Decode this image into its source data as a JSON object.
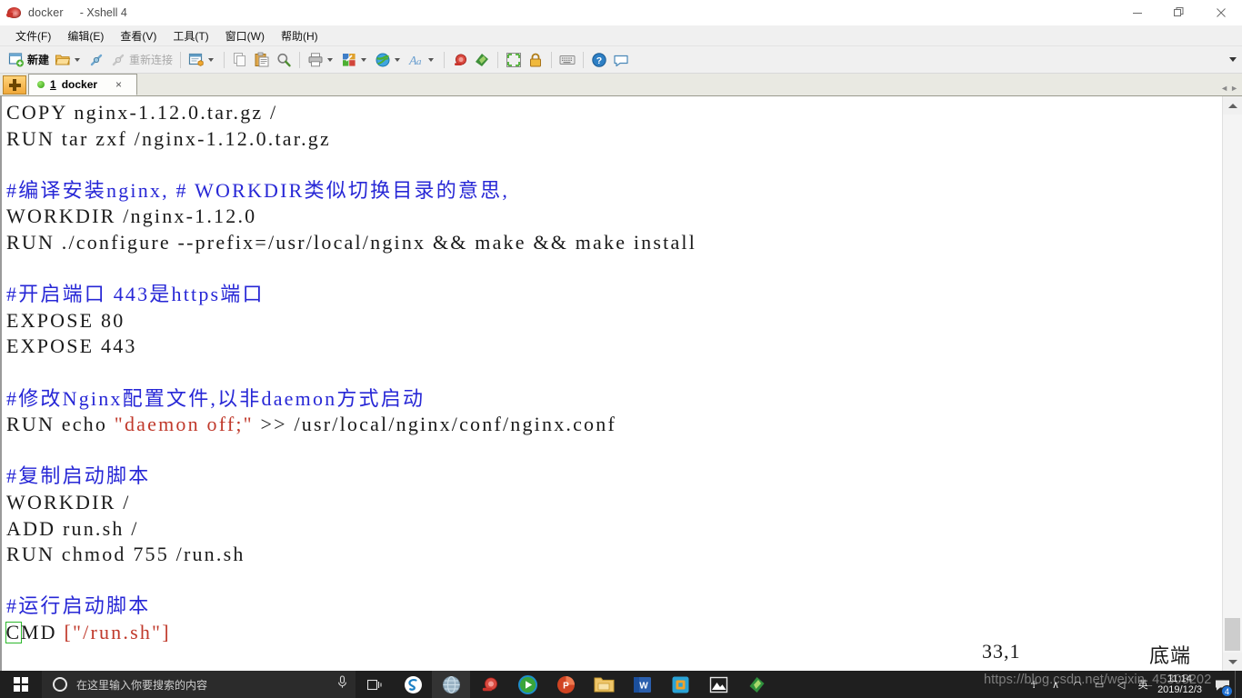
{
  "window": {
    "app_icon": "xshell-snail-icon",
    "title": "docker",
    "subtitle": "- Xshell 4",
    "controls": {
      "minimize": "minimize-icon",
      "maximize": "maximize-icon",
      "close": "close-icon"
    }
  },
  "menubar": {
    "items": [
      {
        "label": "文件(F)",
        "name": "menu-file"
      },
      {
        "label": "编辑(E)",
        "name": "menu-edit"
      },
      {
        "label": "查看(V)",
        "name": "menu-view"
      },
      {
        "label": "工具(T)",
        "name": "menu-tools"
      },
      {
        "label": "窗口(W)",
        "name": "menu-window"
      },
      {
        "label": "帮助(H)",
        "name": "menu-help"
      }
    ]
  },
  "toolbar": {
    "new_label": "新建",
    "reconnect_label": "重新连接",
    "overflow": "toolbar-overflow-icon"
  },
  "tabstrip": {
    "new_tab": "new-tab-button",
    "tabs": [
      {
        "index": "1",
        "title": "docker",
        "close": "×",
        "status": "connected"
      }
    ]
  },
  "terminal": {
    "lines": [
      [
        {
          "t": "COPY nginx-1.12.0.tar.gz /",
          "c": "plain"
        }
      ],
      [
        {
          "t": "RUN tar zxf /nginx-1.12.0.tar.gz",
          "c": "plain"
        }
      ],
      [
        {
          "t": "",
          "c": "plain"
        }
      ],
      [
        {
          "t": "#编译安装nginx, # WORKDIR类似切换目录的意思,",
          "c": "comment"
        }
      ],
      [
        {
          "t": "WORKDIR /nginx-1.12.0",
          "c": "plain"
        }
      ],
      [
        {
          "t": "RUN ./configure --prefix=/usr/local/nginx && make && make install",
          "c": "plain"
        }
      ],
      [
        {
          "t": "",
          "c": "plain"
        }
      ],
      [
        {
          "t": "#开启端口 443是https端口",
          "c": "comment"
        }
      ],
      [
        {
          "t": "EXPOSE 80",
          "c": "plain"
        }
      ],
      [
        {
          "t": "EXPOSE 443",
          "c": "plain"
        }
      ],
      [
        {
          "t": "",
          "c": "plain"
        }
      ],
      [
        {
          "t": "#修改Nginx配置文件,以非daemon方式启动",
          "c": "comment"
        }
      ],
      [
        {
          "t": "RUN echo ",
          "c": "plain"
        },
        {
          "t": "\"daemon off;\"",
          "c": "str"
        },
        {
          "t": " >> /usr/local/nginx/conf/nginx.conf",
          "c": "plain"
        }
      ],
      [
        {
          "t": "",
          "c": "plain"
        }
      ],
      [
        {
          "t": "#复制启动脚本",
          "c": "comment"
        }
      ],
      [
        {
          "t": "WORKDIR /",
          "c": "plain"
        }
      ],
      [
        {
          "t": "ADD run.sh /",
          "c": "plain"
        }
      ],
      [
        {
          "t": "RUN chmod 755 /run.sh",
          "c": "plain"
        }
      ],
      [
        {
          "t": "",
          "c": "plain"
        }
      ],
      [
        {
          "t": "#运行启动脚本",
          "c": "comment"
        }
      ],
      [
        {
          "t": "C",
          "c": "cursor"
        },
        {
          "t": "MD ",
          "c": "plain"
        },
        {
          "t": "[\"/run.sh\"]",
          "c": "str"
        }
      ]
    ],
    "status": {
      "position": "33,1",
      "location": "底端"
    },
    "colors": {
      "comment": "#2727d6",
      "string": "#c0392b",
      "text": "#1a1a1a",
      "cursor": "#2cb82c",
      "background": "#ffffff"
    }
  },
  "scrollbar": {
    "up": "scroll-up-arrow",
    "down": "scroll-down-arrow",
    "thumb": "scroll-thumb"
  },
  "taskbar": {
    "start": "windows-start-icon",
    "search_placeholder": "在这里输入你要搜索的内容",
    "mic": "microphone-icon",
    "task_view": "task-view-icon",
    "apps": [
      {
        "name": "sogou-input-icon",
        "active": false
      },
      {
        "name": "globe-browser-icon",
        "active": true
      },
      {
        "name": "xshell-snail-icon",
        "active": false
      },
      {
        "name": "media-player-icon",
        "active": false
      },
      {
        "name": "powerpoint-icon",
        "active": false
      },
      {
        "name": "file-explorer-icon",
        "active": false
      },
      {
        "name": "word-icon",
        "active": false
      },
      {
        "name": "vmware-icon",
        "active": false
      },
      {
        "name": "photo-viewer-icon",
        "active": false
      },
      {
        "name": "green-book-icon",
        "active": false
      }
    ],
    "tray": [
      {
        "name": "people-icon",
        "glyph": "☥"
      },
      {
        "name": "hidden-icons-chevron",
        "glyph": "∧"
      },
      {
        "name": "network-icon",
        "glyph": "◠"
      },
      {
        "name": "battery-icon",
        "glyph": "▭"
      },
      {
        "name": "volume-icon",
        "glyph": "◁"
      },
      {
        "name": "ime-language-icon",
        "glyph": "英"
      }
    ],
    "clock": {
      "time": "11:14",
      "date": "2019/12/3"
    },
    "notifications": {
      "icon": "action-center-icon",
      "count": "4"
    }
  },
  "watermark": {
    "text": "https://blog.csdn.net/weixin_45308202"
  }
}
